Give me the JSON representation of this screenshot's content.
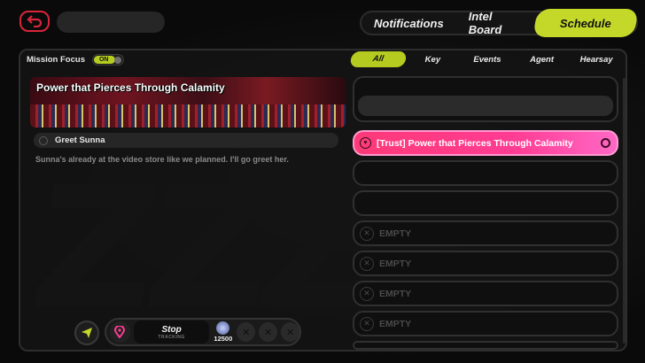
{
  "top": {
    "tabs": [
      {
        "label": "Notifications"
      },
      {
        "label": "Intel Board"
      },
      {
        "label": "Schedule",
        "active": true
      }
    ]
  },
  "mission_focus": {
    "label": "Mission Focus",
    "toggle_text": "ON",
    "on": true
  },
  "filters": [
    {
      "label": "All",
      "active": true
    },
    {
      "label": "Key"
    },
    {
      "label": "Events"
    },
    {
      "label": "Agent"
    },
    {
      "label": "Hearsay"
    }
  ],
  "detail": {
    "title": "Power that Pierces Through Calamity",
    "objective": "Greet Sunna",
    "description": "Sunna's already at the video store like we planned. I'll go greet her."
  },
  "tracking": {
    "stop_label": "Stop",
    "tracking_label": "TRACKING",
    "reward_value": "12500"
  },
  "list": {
    "active_item": "[Trust] Power that Pierces Through Calamity",
    "empty_label": "EMPTY"
  },
  "colors": {
    "accent": "#c4d82a",
    "active_row": "#ff3c93",
    "back": "#d9263a"
  }
}
